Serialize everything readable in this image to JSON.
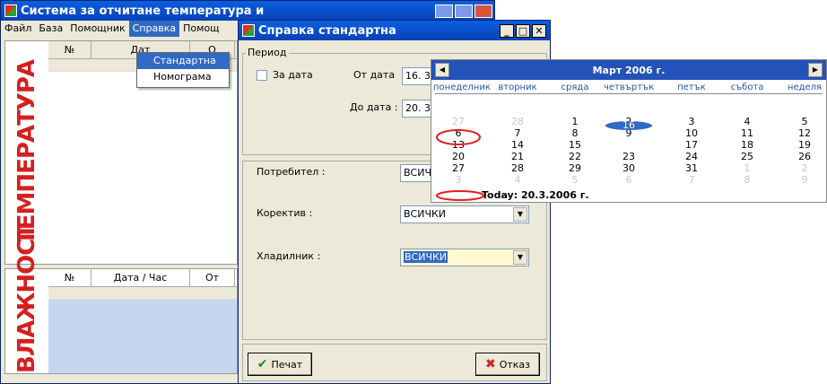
{
  "main_window": {
    "title": "Система за отчитане температура и",
    "menu": [
      "Файл",
      "База",
      "Помощник",
      "Справка",
      "Помощ"
    ],
    "selected_menu_index": 3,
    "side_labels": {
      "top": "ТЕМПЕРАТУРА",
      "bottom": "ВЛАЖНОСТ"
    },
    "top_table_headers": [
      "№",
      "Дат",
      "О"
    ],
    "bottom_table_headers": [
      "№",
      "Дата / Час",
      "От"
    ]
  },
  "dropdown_menu": {
    "items": [
      "Стандартна",
      "Номограма"
    ],
    "highlighted_index": 0
  },
  "dialog": {
    "title": "Справка стандартна",
    "period_label": "Период",
    "za_data_label": "За дата",
    "ot_data_label": "От дата",
    "ot_data_value": "16. 3.",
    "do_data_label": "До дата :",
    "do_data_value": "20. 3.",
    "potrebitel_label": "Потребител :",
    "potrebitel_value": "ВСИЧ",
    "korektiv_label": "Коректив :",
    "korektiv_value": "ВСИЧКИ",
    "hladilnik_label": "Хладилник :",
    "hladilnik_value": "ВСИЧКИ",
    "print_label": "Печат",
    "cancel_label": "Отказ"
  },
  "calendar": {
    "month_title": "Март 2006 г.",
    "weekdays": [
      "понеделник",
      "вторник",
      "сряда",
      "четвъртък",
      "петък",
      "събота",
      "неделя"
    ],
    "weeks": [
      [
        "27",
        "28",
        "1",
        "2",
        "3",
        "4",
        "5"
      ],
      [
        "6",
        "7",
        "8",
        "9",
        "10",
        "11",
        "12"
      ],
      [
        "13",
        "14",
        "15",
        "16",
        "17",
        "18",
        "19"
      ],
      [
        "20",
        "21",
        "22",
        "23",
        "24",
        "25",
        "26"
      ],
      [
        "27",
        "28",
        "29",
        "30",
        "31",
        "1",
        "2"
      ],
      [
        "3",
        "4",
        "5",
        "6",
        "7",
        "8",
        "9"
      ]
    ],
    "dim_cells": [
      [
        0,
        0
      ],
      [
        0,
        1
      ],
      [
        4,
        5
      ],
      [
        4,
        6
      ],
      [
        5,
        0
      ],
      [
        5,
        1
      ],
      [
        5,
        2
      ],
      [
        5,
        3
      ],
      [
        5,
        4
      ],
      [
        5,
        5
      ],
      [
        5,
        6
      ]
    ],
    "selected_cell": [
      2,
      3
    ],
    "circled_cell": [
      3,
      0
    ],
    "today_text": "Today: 20.3.2006 г."
  },
  "colors": {
    "title_blue": "#0a5fe0",
    "side_red": "#d42020",
    "selection": "#316ac5",
    "circle_red": "#e02020"
  }
}
